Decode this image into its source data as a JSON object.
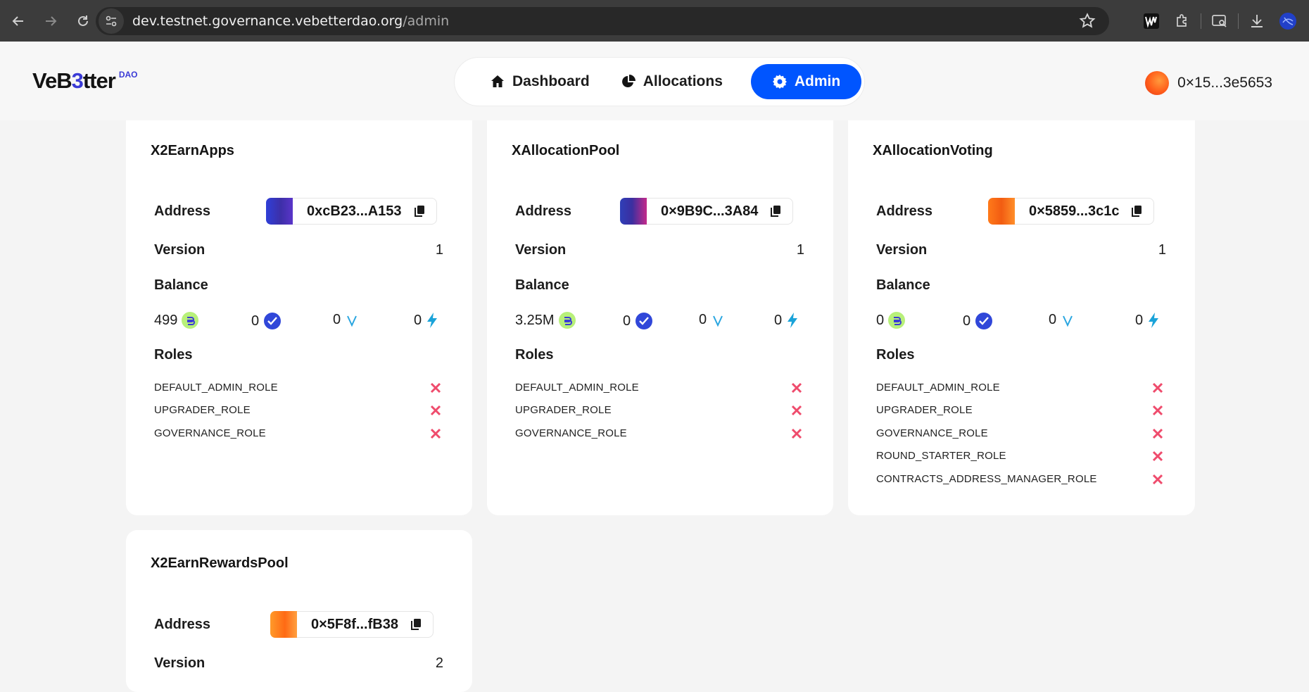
{
  "browser": {
    "url_host": "dev.testnet.governance.vebetterdao.org",
    "url_path": "/admin"
  },
  "app": {
    "logo_text_a": "VeB",
    "logo_text_b": "3",
    "logo_text_c": "tter",
    "logo_badge": "DAO",
    "nav": {
      "dashboard": "Dashboard",
      "allocations": "Allocations",
      "admin": "Admin"
    },
    "wallet": "0×15...3e5653",
    "accent": "#0055ff"
  },
  "labels": {
    "address": "Address",
    "version": "Version",
    "balance": "Balance",
    "roles": "Roles"
  },
  "cards": [
    {
      "title": "X2EarnApps",
      "address": "0xcB23...A153",
      "version": "1",
      "balances": [
        "499",
        "0",
        "0",
        "0"
      ],
      "roles": [
        "DEFAULT_ADMIN_ROLE",
        "UPGRADER_ROLE",
        "GOVERNANCE_ROLE"
      ]
    },
    {
      "title": "XAllocationPool",
      "address": "0×9B9C...3A84",
      "version": "1",
      "balances": [
        "3.25M",
        "0",
        "0",
        "0"
      ],
      "roles": [
        "DEFAULT_ADMIN_ROLE",
        "UPGRADER_ROLE",
        "GOVERNANCE_ROLE"
      ]
    },
    {
      "title": "XAllocationVoting",
      "address": "0×5859...3c1c",
      "version": "1",
      "balances": [
        "0",
        "0",
        "0",
        "0"
      ],
      "roles": [
        "DEFAULT_ADMIN_ROLE",
        "UPGRADER_ROLE",
        "GOVERNANCE_ROLE",
        "ROUND_STARTER_ROLE",
        "CONTRACTS_ADDRESS_MANAGER_ROLE"
      ]
    },
    {
      "title": "X2EarnRewardsPool",
      "address": "0×5F8f...fB38",
      "version": "2"
    }
  ]
}
